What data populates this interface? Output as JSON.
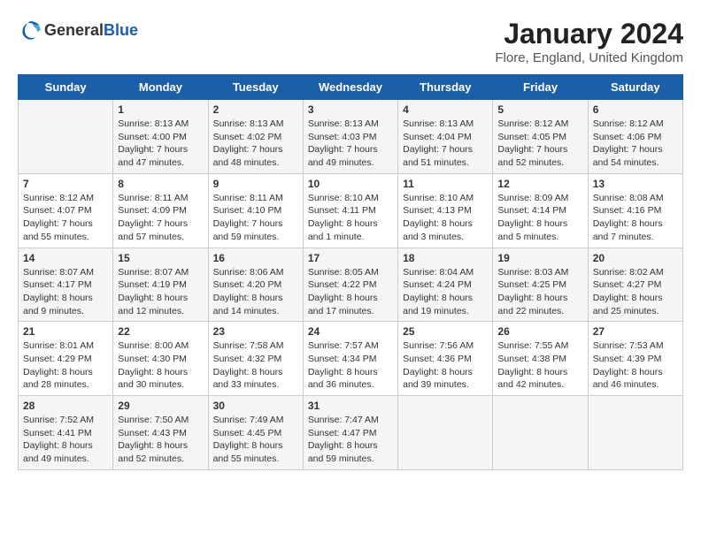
{
  "logo": {
    "general": "General",
    "blue": "Blue"
  },
  "header": {
    "month": "January 2024",
    "location": "Flore, England, United Kingdom"
  },
  "weekdays": [
    "Sunday",
    "Monday",
    "Tuesday",
    "Wednesday",
    "Thursday",
    "Friday",
    "Saturday"
  ],
  "weeks": [
    [
      {
        "day": "",
        "lines": []
      },
      {
        "day": "1",
        "lines": [
          "Sunrise: 8:13 AM",
          "Sunset: 4:00 PM",
          "Daylight: 7 hours",
          "and 47 minutes."
        ]
      },
      {
        "day": "2",
        "lines": [
          "Sunrise: 8:13 AM",
          "Sunset: 4:02 PM",
          "Daylight: 7 hours",
          "and 48 minutes."
        ]
      },
      {
        "day": "3",
        "lines": [
          "Sunrise: 8:13 AM",
          "Sunset: 4:03 PM",
          "Daylight: 7 hours",
          "and 49 minutes."
        ]
      },
      {
        "day": "4",
        "lines": [
          "Sunrise: 8:13 AM",
          "Sunset: 4:04 PM",
          "Daylight: 7 hours",
          "and 51 minutes."
        ]
      },
      {
        "day": "5",
        "lines": [
          "Sunrise: 8:12 AM",
          "Sunset: 4:05 PM",
          "Daylight: 7 hours",
          "and 52 minutes."
        ]
      },
      {
        "day": "6",
        "lines": [
          "Sunrise: 8:12 AM",
          "Sunset: 4:06 PM",
          "Daylight: 7 hours",
          "and 54 minutes."
        ]
      }
    ],
    [
      {
        "day": "7",
        "lines": [
          "Sunrise: 8:12 AM",
          "Sunset: 4:07 PM",
          "Daylight: 7 hours",
          "and 55 minutes."
        ]
      },
      {
        "day": "8",
        "lines": [
          "Sunrise: 8:11 AM",
          "Sunset: 4:09 PM",
          "Daylight: 7 hours",
          "and 57 minutes."
        ]
      },
      {
        "day": "9",
        "lines": [
          "Sunrise: 8:11 AM",
          "Sunset: 4:10 PM",
          "Daylight: 7 hours",
          "and 59 minutes."
        ]
      },
      {
        "day": "10",
        "lines": [
          "Sunrise: 8:10 AM",
          "Sunset: 4:11 PM",
          "Daylight: 8 hours",
          "and 1 minute."
        ]
      },
      {
        "day": "11",
        "lines": [
          "Sunrise: 8:10 AM",
          "Sunset: 4:13 PM",
          "Daylight: 8 hours",
          "and 3 minutes."
        ]
      },
      {
        "day": "12",
        "lines": [
          "Sunrise: 8:09 AM",
          "Sunset: 4:14 PM",
          "Daylight: 8 hours",
          "and 5 minutes."
        ]
      },
      {
        "day": "13",
        "lines": [
          "Sunrise: 8:08 AM",
          "Sunset: 4:16 PM",
          "Daylight: 8 hours",
          "and 7 minutes."
        ]
      }
    ],
    [
      {
        "day": "14",
        "lines": [
          "Sunrise: 8:07 AM",
          "Sunset: 4:17 PM",
          "Daylight: 8 hours",
          "and 9 minutes."
        ]
      },
      {
        "day": "15",
        "lines": [
          "Sunrise: 8:07 AM",
          "Sunset: 4:19 PM",
          "Daylight: 8 hours",
          "and 12 minutes."
        ]
      },
      {
        "day": "16",
        "lines": [
          "Sunrise: 8:06 AM",
          "Sunset: 4:20 PM",
          "Daylight: 8 hours",
          "and 14 minutes."
        ]
      },
      {
        "day": "17",
        "lines": [
          "Sunrise: 8:05 AM",
          "Sunset: 4:22 PM",
          "Daylight: 8 hours",
          "and 17 minutes."
        ]
      },
      {
        "day": "18",
        "lines": [
          "Sunrise: 8:04 AM",
          "Sunset: 4:24 PM",
          "Daylight: 8 hours",
          "and 19 minutes."
        ]
      },
      {
        "day": "19",
        "lines": [
          "Sunrise: 8:03 AM",
          "Sunset: 4:25 PM",
          "Daylight: 8 hours",
          "and 22 minutes."
        ]
      },
      {
        "day": "20",
        "lines": [
          "Sunrise: 8:02 AM",
          "Sunset: 4:27 PM",
          "Daylight: 8 hours",
          "and 25 minutes."
        ]
      }
    ],
    [
      {
        "day": "21",
        "lines": [
          "Sunrise: 8:01 AM",
          "Sunset: 4:29 PM",
          "Daylight: 8 hours",
          "and 28 minutes."
        ]
      },
      {
        "day": "22",
        "lines": [
          "Sunrise: 8:00 AM",
          "Sunset: 4:30 PM",
          "Daylight: 8 hours",
          "and 30 minutes."
        ]
      },
      {
        "day": "23",
        "lines": [
          "Sunrise: 7:58 AM",
          "Sunset: 4:32 PM",
          "Daylight: 8 hours",
          "and 33 minutes."
        ]
      },
      {
        "day": "24",
        "lines": [
          "Sunrise: 7:57 AM",
          "Sunset: 4:34 PM",
          "Daylight: 8 hours",
          "and 36 minutes."
        ]
      },
      {
        "day": "25",
        "lines": [
          "Sunrise: 7:56 AM",
          "Sunset: 4:36 PM",
          "Daylight: 8 hours",
          "and 39 minutes."
        ]
      },
      {
        "day": "26",
        "lines": [
          "Sunrise: 7:55 AM",
          "Sunset: 4:38 PM",
          "Daylight: 8 hours",
          "and 42 minutes."
        ]
      },
      {
        "day": "27",
        "lines": [
          "Sunrise: 7:53 AM",
          "Sunset: 4:39 PM",
          "Daylight: 8 hours",
          "and 46 minutes."
        ]
      }
    ],
    [
      {
        "day": "28",
        "lines": [
          "Sunrise: 7:52 AM",
          "Sunset: 4:41 PM",
          "Daylight: 8 hours",
          "and 49 minutes."
        ]
      },
      {
        "day": "29",
        "lines": [
          "Sunrise: 7:50 AM",
          "Sunset: 4:43 PM",
          "Daylight: 8 hours",
          "and 52 minutes."
        ]
      },
      {
        "day": "30",
        "lines": [
          "Sunrise: 7:49 AM",
          "Sunset: 4:45 PM",
          "Daylight: 8 hours",
          "and 55 minutes."
        ]
      },
      {
        "day": "31",
        "lines": [
          "Sunrise: 7:47 AM",
          "Sunset: 4:47 PM",
          "Daylight: 8 hours",
          "and 59 minutes."
        ]
      },
      {
        "day": "",
        "lines": []
      },
      {
        "day": "",
        "lines": []
      },
      {
        "day": "",
        "lines": []
      }
    ]
  ]
}
